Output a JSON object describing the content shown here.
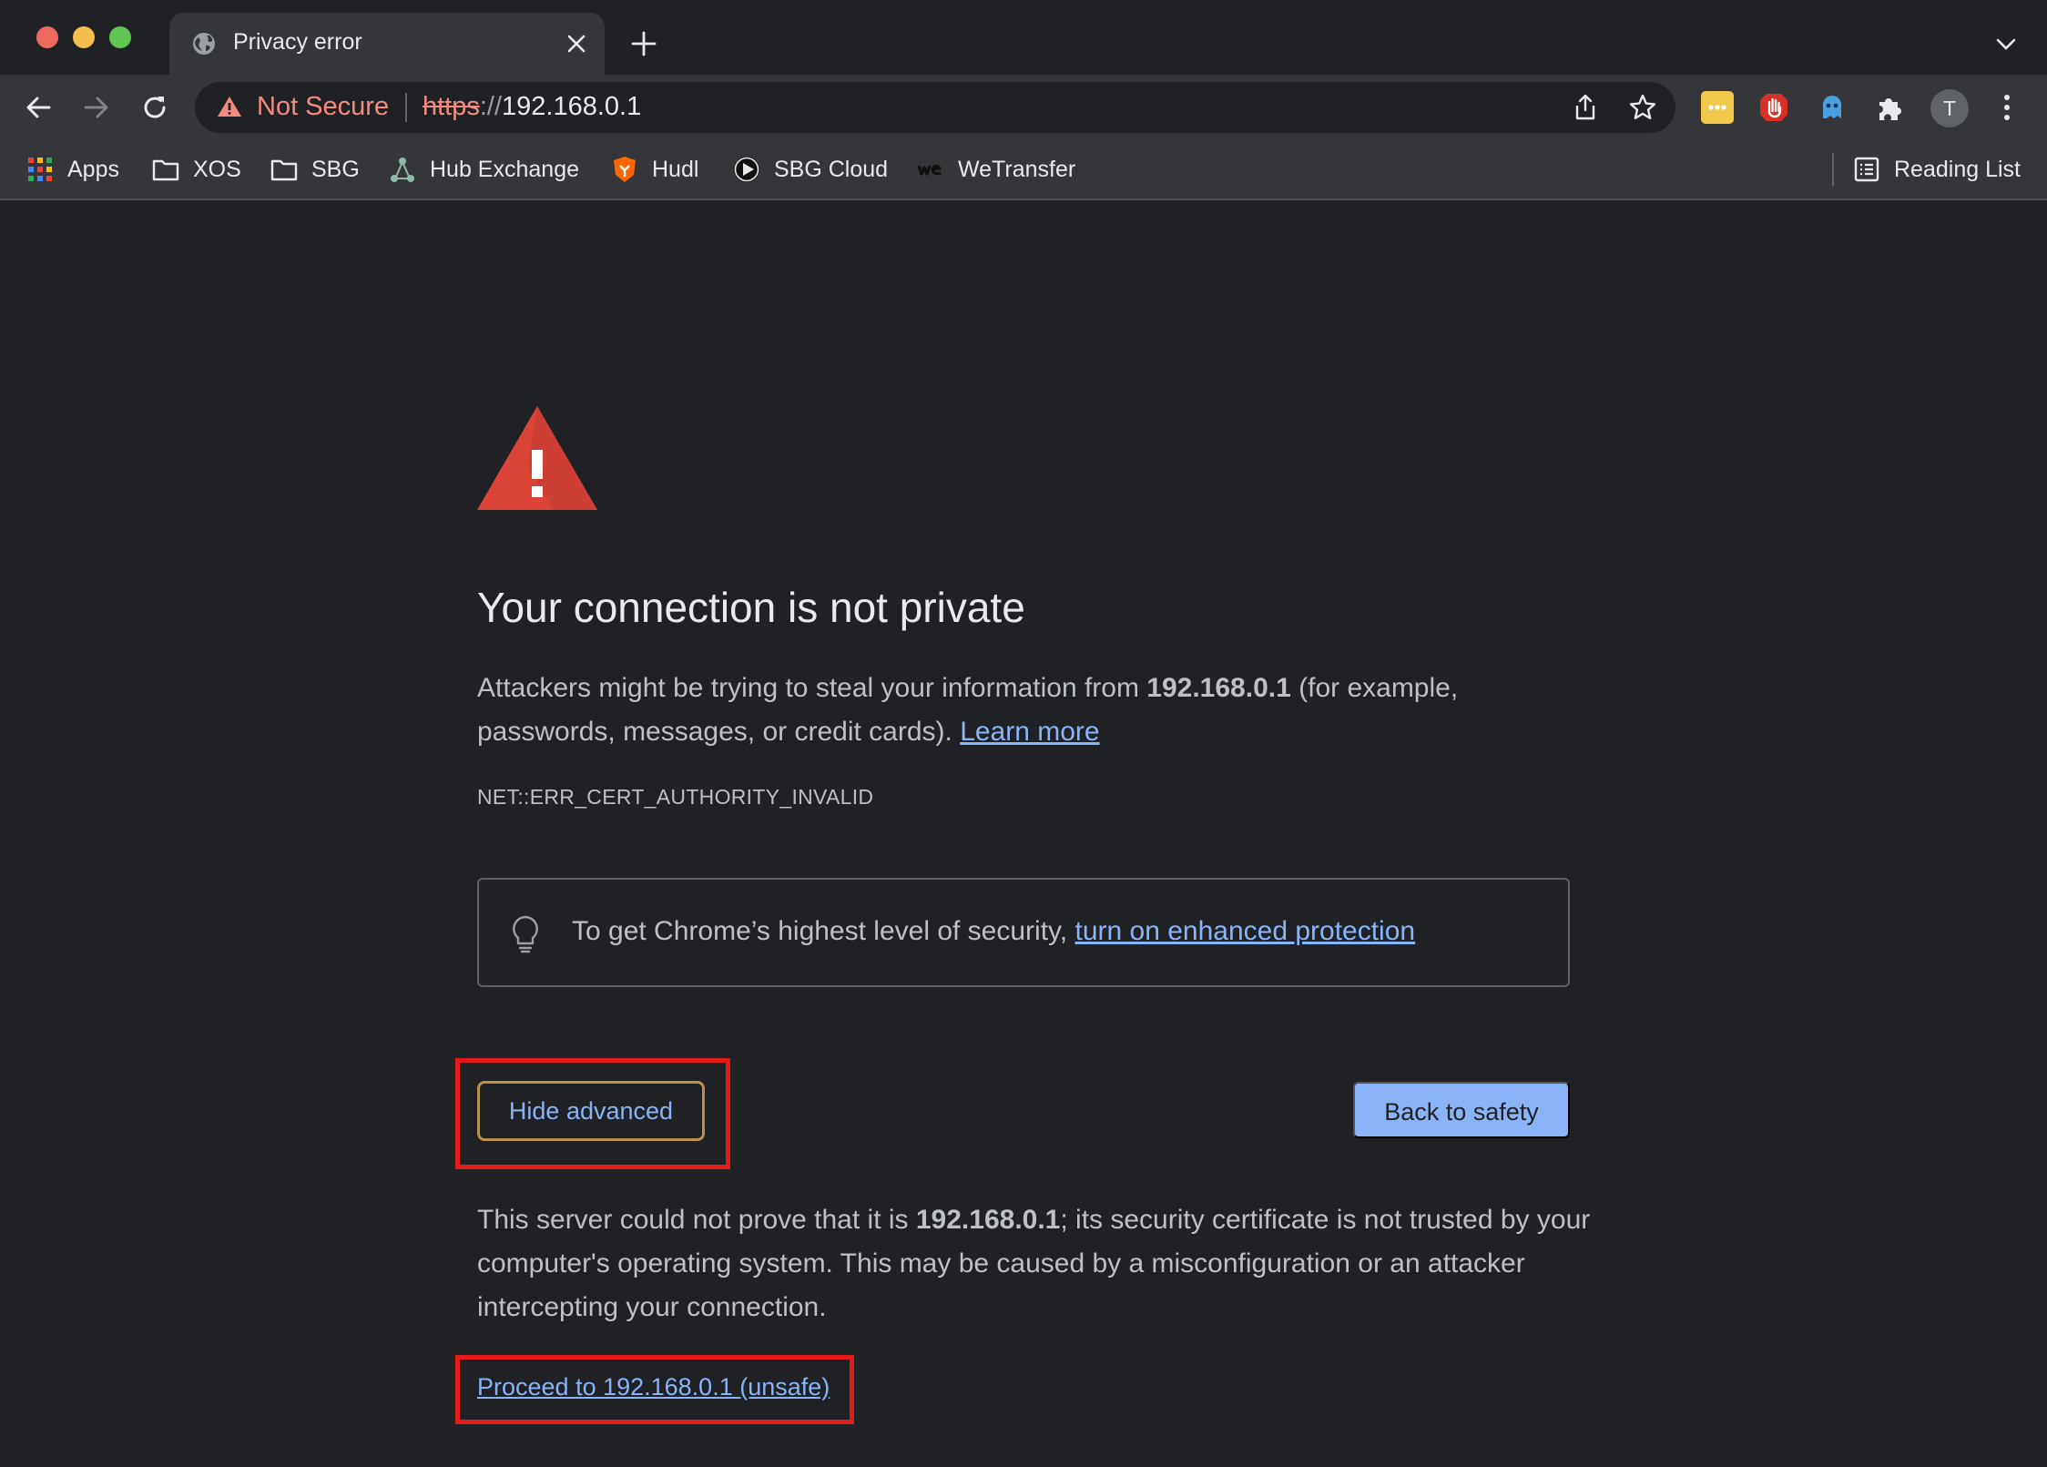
{
  "tab": {
    "title": "Privacy error"
  },
  "omnibox": {
    "security_label": "Not Secure",
    "url_scheme": "https",
    "url_sep": "://",
    "url_host": "192.168.0.1"
  },
  "profile": {
    "initial": "T"
  },
  "bookmarks": {
    "items": [
      {
        "label": "Apps",
        "icon": "apps-grid-icon"
      },
      {
        "label": "XOS",
        "icon": "folder-icon"
      },
      {
        "label": "SBG",
        "icon": "folder-icon"
      },
      {
        "label": "Hub Exchange",
        "icon": "hub-exchange-icon"
      },
      {
        "label": "Hudl",
        "icon": "hudl-icon"
      },
      {
        "label": "SBG Cloud",
        "icon": "play-circle-icon"
      },
      {
        "label": "WeTransfer",
        "icon": "wetransfer-icon"
      }
    ],
    "reading_list": "Reading List"
  },
  "page": {
    "heading": "Your connection is not private",
    "intro_prefix": "Attackers might be trying to steal your information from ",
    "intro_host": "192.168.0.1",
    "intro_suffix": " (for example, passwords, messages, or credit cards). ",
    "learn_more": "Learn more",
    "error_code": "NET::ERR_CERT_AUTHORITY_INVALID",
    "enhanced_prefix": "To get Chrome’s highest level of security, ",
    "enhanced_link": "turn on enhanced protection",
    "hide_advanced": "Hide advanced",
    "back_to_safety": "Back to safety",
    "detail_prefix": "This server could not prove that it is ",
    "detail_host": "192.168.0.1",
    "detail_suffix": "; its security certificate is not trusted by your computer's operating system. This may be caused by a misconfiguration or an attacker intercepting your connection.",
    "proceed_link": "Proceed to 192.168.0.1 (unsafe)"
  },
  "colors": {
    "background": "#202124",
    "toolbar": "#35363a",
    "link": "#8ab4f8",
    "warning_red": "#db4437",
    "not_secure": "#f28b82",
    "annotation_red": "#e21a1a"
  }
}
